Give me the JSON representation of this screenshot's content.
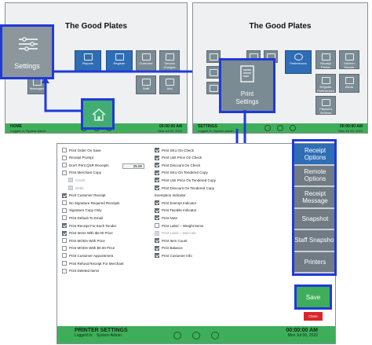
{
  "app_title": "The Good Plates",
  "home_screen": {
    "title": "The Good Plates",
    "tiles": [
      "Reports",
      "Register",
      "Customer",
      "Service Charges",
      "Messages",
      "Staff",
      "Add"
    ],
    "status": {
      "name": "HOME",
      "logged_in": "Logged In: System Admin",
      "time": "00:00:00 AM",
      "date": "Mon Jul 00, 2022"
    }
  },
  "settings_screen": {
    "title": "The Good Plates",
    "tiles": [
      "Preferences",
      "Printer Settings",
      "Receipt Printer",
      "Kitchen Display",
      "Register Preferences",
      "Payment Settings",
      "Alerts"
    ],
    "status": {
      "name": "SETTINGS",
      "logged_in": "Logged In: System Admin",
      "time": "00:00:00 AM",
      "date": "Mon Jul 00, 2022"
    }
  },
  "callouts": {
    "settings_label": "Settings",
    "printer_settings_label": "Print\nSettings",
    "home_icon": "home-icon"
  },
  "printer_settings": {
    "left_options": [
      {
        "label": "Print Order On Save",
        "checked": false,
        "disabled": false
      },
      {
        "label": "Receipt Prompt",
        "checked": false,
        "disabled": false
      },
      {
        "label": "Don't Print QSR Receipts",
        "checked": false,
        "disabled": false
      },
      {
        "label": "Print Merchant Copy",
        "checked": false,
        "disabled": false
      },
      {
        "label": "Credit",
        "checked": false,
        "disabled": true
      },
      {
        "label": "Debit",
        "checked": false,
        "disabled": true
      },
      {
        "label": "Print Customer Receipt",
        "checked": true,
        "disabled": false
      },
      {
        "label": "No Signature Required Receipts",
        "checked": false,
        "disabled": false
      },
      {
        "label": "Signature Copy Only",
        "checked": false,
        "disabled": false
      },
      {
        "label": "Print Default To Email",
        "checked": false,
        "disabled": false
      },
      {
        "label": "Print Receipt For Each Tender",
        "checked": true,
        "disabled": false
      },
      {
        "label": "Print Items With $0.00 Price",
        "checked": true,
        "disabled": false
      },
      {
        "label": "Print MODS With Price",
        "checked": false,
        "disabled": false
      },
      {
        "label": "Print MODS With $0.00 Price",
        "checked": false,
        "disabled": false
      },
      {
        "label": "Print Customer Appointment",
        "checked": false,
        "disabled": false
      },
      {
        "label": "Print Refund Receipt For Merchant",
        "checked": false,
        "disabled": false
      },
      {
        "label": "Print Deleted Items",
        "checked": false,
        "disabled": false
      }
    ],
    "qsr_value": "25.00",
    "right_options": [
      {
        "label": "Print SKU On Check",
        "checked": true,
        "disabled": false
      },
      {
        "label": "Print Unit Price On Check",
        "checked": true,
        "disabled": false
      },
      {
        "label": "Print Discount On Check",
        "checked": true,
        "disabled": false
      },
      {
        "label": "Print SKU On Tendered Copy",
        "checked": true,
        "disabled": false
      },
      {
        "label": "Print Unit Price On Tendered Copy",
        "checked": true,
        "disabled": false
      },
      {
        "label": "Print Discount On Tendered Copy",
        "checked": true,
        "disabled": false
      },
      {
        "label": "Exemption Indicator",
        "checked": false,
        "disabled": false,
        "header": true
      },
      {
        "label": "Print Exempt Indicator",
        "checked": true,
        "disabled": false
      },
      {
        "label": "Print Taxable Indicator",
        "checked": true,
        "disabled": false
      },
      {
        "label": "Print Note",
        "checked": true,
        "disabled": false
      },
      {
        "label": "Print Label -- Weight Items",
        "checked": false,
        "disabled": false
      },
      {
        "label": "Print Label -- Barcode",
        "checked": false,
        "disabled": true
      },
      {
        "label": "Print Item Count",
        "checked": true,
        "disabled": false
      },
      {
        "label": "Print Balance",
        "checked": true,
        "disabled": false
      },
      {
        "label": "Print Customer Info",
        "checked": true,
        "disabled": false
      }
    ],
    "side_buttons": [
      {
        "label": "Receipt Options",
        "selected": true
      },
      {
        "label": "Remote Options",
        "selected": false
      },
      {
        "label": "Receipt Message",
        "selected": false
      },
      {
        "label": "Snapshot",
        "selected": false
      },
      {
        "label": "Staff Snapshot",
        "selected": false
      },
      {
        "label": "Printers",
        "selected": false
      }
    ],
    "save_label": "Save",
    "close_label": "Close",
    "status": {
      "name": "PRINTER SETTINGS",
      "logged_in": "Logged In:",
      "user": "System Admin",
      "time": "00:00:00 AM",
      "date": "Mon Jul 00, 2022"
    }
  },
  "colors": {
    "highlight": "#1f3ad9",
    "status_green": "#3fae5a",
    "selected_blue": "#2f6db5",
    "save_green": "#3fae5a",
    "close_red": "#d9262c"
  }
}
